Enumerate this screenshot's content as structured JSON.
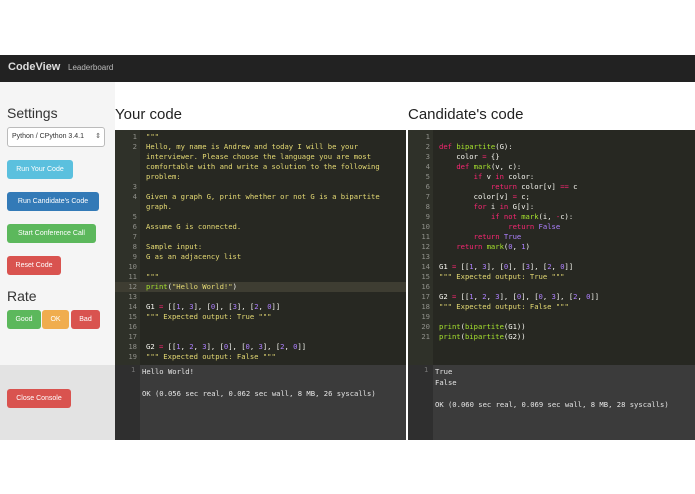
{
  "nav": {
    "brand": "CodeView",
    "leaderboard": "Leaderboard"
  },
  "settings": {
    "title": "Settings",
    "language": "Python / CPython 3.4.1",
    "run_your_code": "Run Your Code",
    "run_candidate_code": "Run Candidate's Code",
    "start_conference": "Start Conference Call",
    "reset_code": "Reset Code"
  },
  "rate": {
    "title": "Rate",
    "good": "Good",
    "ok": "OK",
    "bad": "Bad"
  },
  "close_console": "Close Console",
  "your_code": {
    "title": "Your code",
    "lines": [
      {
        "n": "1",
        "text": "\"\"\""
      },
      {
        "n": "2",
        "text": "Hello, my name is Andrew and today I will be your"
      },
      {
        "n": "",
        "text": "interviewer. Please choose the language you are most"
      },
      {
        "n": "",
        "text": "comfortable with and write a solution to the following"
      },
      {
        "n": "",
        "text": "problem:"
      },
      {
        "n": "3",
        "text": ""
      },
      {
        "n": "4",
        "text": "Given a graph G, print whether or not G is a bipartite"
      },
      {
        "n": "",
        "text": "graph."
      },
      {
        "n": "5",
        "text": ""
      },
      {
        "n": "6",
        "text": "Assume G is connected."
      },
      {
        "n": "7",
        "text": ""
      },
      {
        "n": "8",
        "text": "Sample input:"
      },
      {
        "n": "9",
        "text": "G as an adjacency list"
      },
      {
        "n": "10",
        "text": ""
      },
      {
        "n": "11",
        "text": "\"\"\""
      },
      {
        "n": "12",
        "text": "print(\"Hello World!\")"
      },
      {
        "n": "13",
        "text": ""
      },
      {
        "n": "14",
        "text": "G1 = [[1, 3], [0], [3], [2, 0]]"
      },
      {
        "n": "15",
        "text": "\"\"\" Expected output: True \"\"\""
      },
      {
        "n": "16",
        "text": ""
      },
      {
        "n": "17",
        "text": ""
      },
      {
        "n": "18",
        "text": "G2 = [[1, 2, 3], [0], [0, 3], [2, 0]]"
      },
      {
        "n": "19",
        "text": "\"\"\" Expected output: False \"\"\""
      }
    ]
  },
  "candidate_code": {
    "title": "Candidate's code",
    "lines": [
      {
        "n": "1",
        "text": ""
      },
      {
        "n": "2",
        "text": "def bipartite(G):"
      },
      {
        "n": "3",
        "text": "    color = {}"
      },
      {
        "n": "4",
        "text": "    def mark(v, c):"
      },
      {
        "n": "5",
        "text": "        if v in color:"
      },
      {
        "n": "6",
        "text": "            return color[v] == c"
      },
      {
        "n": "7",
        "text": "        color[v] = c;"
      },
      {
        "n": "8",
        "text": "        for i in G[v]:"
      },
      {
        "n": "9",
        "text": "            if not mark(i, -c):"
      },
      {
        "n": "10",
        "text": "                return False"
      },
      {
        "n": "11",
        "text": "        return True"
      },
      {
        "n": "12",
        "text": "    return mark(0, 1)"
      },
      {
        "n": "13",
        "text": ""
      },
      {
        "n": "14",
        "text": "G1 = [[1, 3], [0], [3], [2, 0]]"
      },
      {
        "n": "15",
        "text": "\"\"\" Expected output: True \"\"\""
      },
      {
        "n": "16",
        "text": ""
      },
      {
        "n": "17",
        "text": "G2 = [[1, 2, 3], [0], [0, 3], [2, 0]]"
      },
      {
        "n": "18",
        "text": "\"\"\" Expected output: False \"\"\""
      },
      {
        "n": "19",
        "text": ""
      },
      {
        "n": "20",
        "text": "print(bipartite(G1))"
      },
      {
        "n": "21",
        "text": "print(bipartite(G2))"
      }
    ]
  },
  "your_console": {
    "lines": [
      "Hello World!",
      "",
      "OK (0.056 sec real, 0.062 sec wall, 8 MB, 26 syscalls)"
    ]
  },
  "candidate_console": {
    "lines": [
      "True",
      "False",
      "",
      "OK (0.060 sec real, 0.069 sec wall, 8 MB, 28 syscalls)"
    ]
  },
  "colors": {
    "run_your_code": "#5bc0de",
    "run_candidate_code": "#337ab7",
    "start_conference": "#5cb85c",
    "reset_code": "#d9534f",
    "good": "#5cb85c",
    "ok": "#f0ad4e",
    "bad": "#d9534f",
    "editor_bg": "#272822",
    "navbar_bg": "#222222"
  }
}
